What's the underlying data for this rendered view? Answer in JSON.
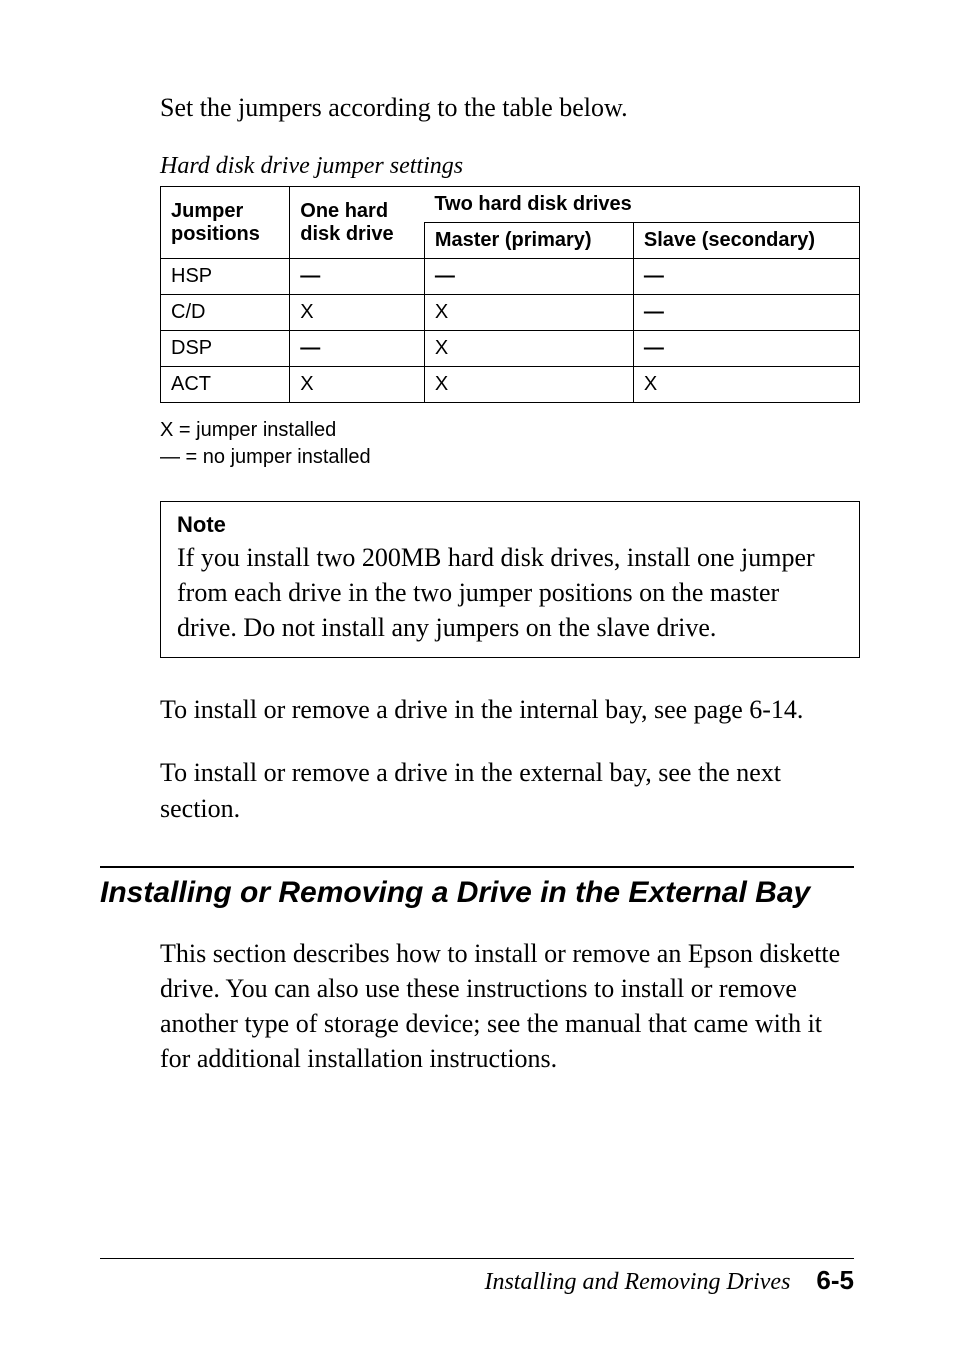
{
  "intro": "Set the jumpers according to the table below.",
  "table_caption": "Hard disk drive jumper settings",
  "table": {
    "col1_header_line1": "Jumper",
    "col1_header_line2": "positions",
    "col2_header_line1": "One hard",
    "col2_header_line2": "disk drive",
    "col34_header": "Two hard disk drives",
    "col3_subheader": "Master (primary)",
    "col4_subheader": "Slave (secondary)",
    "rows": [
      {
        "pos": "HSP",
        "one": "—",
        "master": "—",
        "slave": "—"
      },
      {
        "pos": "C/D",
        "one": "X",
        "master": "X",
        "slave": "—"
      },
      {
        "pos": "DSP",
        "one": "—",
        "master": "X",
        "slave": "—"
      },
      {
        "pos": "ACT",
        "one": "X",
        "master": "X",
        "slave": "X"
      }
    ]
  },
  "legend_line1": "X = jumper installed",
  "legend_line2": "— = no jumper installed",
  "note_title": "Note",
  "note_body": "If you install two 200MB hard disk drives, install one jumper from each drive in the two jumper positions on the master drive. Do not install any jumpers on the slave drive.",
  "para_internal": "To install or remove a drive in the internal bay, see page 6-14.",
  "para_external": "To install or remove a drive in the external bay, see the next section.",
  "section_heading": "Installing or Removing a Drive in the External Bay",
  "section_body": "This section describes how to install or remove an Epson diskette drive. You can also use these instructions to install or remove another type of storage device; see the manual that came with it for additional installation instructions.",
  "footer_title": "Installing and Removing Drives",
  "footer_page": "6-5"
}
